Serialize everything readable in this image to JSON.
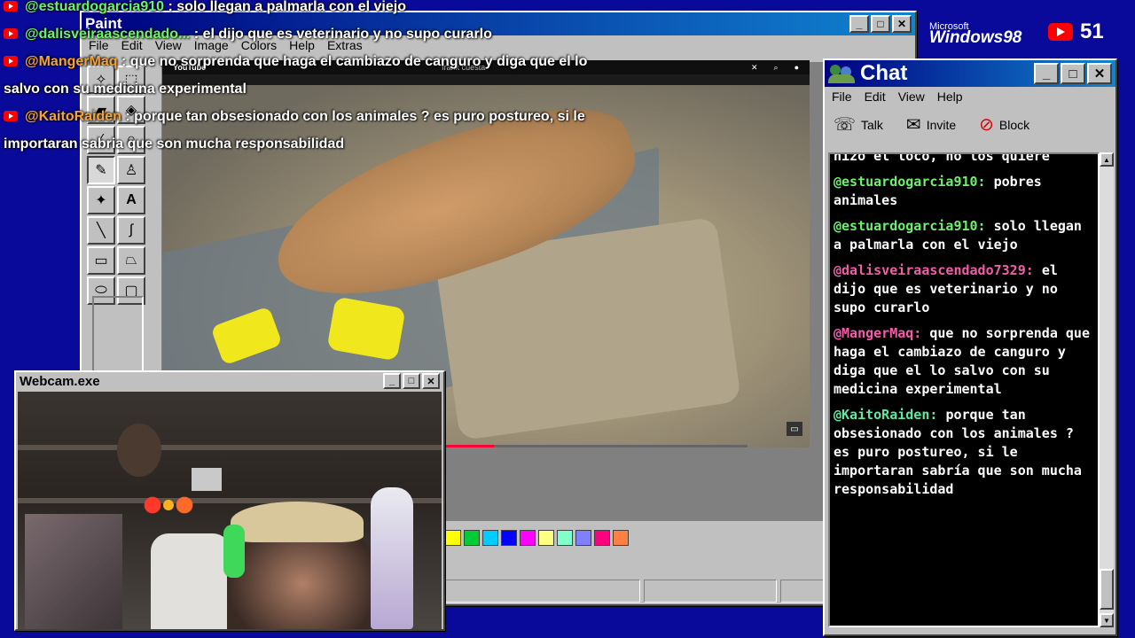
{
  "paint": {
    "title": "Paint",
    "menu": [
      "File",
      "Edit",
      "View",
      "Image",
      "Colors",
      "Help",
      "Extras"
    ]
  },
  "video": {
    "site": "YouTube",
    "query": "frank cuesta",
    "progress_fraction": 0.16
  },
  "palette": [
    "#ffff00",
    "#00cc33",
    "#00ccff",
    "#0000ff",
    "#ff00ff",
    "#ffff80",
    "#80ffcc",
    "#8080ff",
    "#ff0080",
    "#ff8040"
  ],
  "overlay": [
    {
      "user": "@estuardogarcia910",
      "sep": " : ",
      "text": "solo llegan a palmarla con el viejo",
      "color": "green"
    },
    {
      "user": "@dalisveiraascendado...",
      "sep": " : ",
      "text": "el dijo que es veterinario y no supo curarlo",
      "color": "green"
    },
    {
      "user": "@MangerMaq",
      "sep": " : ",
      "text": "que no sorprenda que haga el cambiazo de canguro y diga que el lo salvo con su medicina experimental",
      "color": "orange"
    },
    {
      "user": "@KaitoRaiden",
      "sep": " : ",
      "text": "porque tan obsesionado con los animales ? es puro postureo, si le importaran sabria que son mucha responsabilidad",
      "color": "orange"
    }
  ],
  "brand": {
    "microsoft": "Microsoft",
    "windows": "Windows98",
    "views": "51"
  },
  "chat": {
    "title": "Chat",
    "menu": [
      "File",
      "Edit",
      "View",
      "Help"
    ],
    "toolbar": {
      "talk": "Talk",
      "invite": "Invite",
      "block": "Block"
    },
    "partial_line": "hizo el loco, no los quiere",
    "messages": [
      {
        "user": "@estuardogarcia910:",
        "text": "pobres animales",
        "color": "green"
      },
      {
        "user": "@estuardogarcia910:",
        "text": "solo llegan a palmarla con el viejo",
        "color": "green"
      },
      {
        "user": "@dalisveiraascendado7329:",
        "text": "el dijo que es veterinario y no supo curarlo",
        "color": "pink"
      },
      {
        "user": "@MangerMaq:",
        "text": "que no sorprenda que haga el cambiazo de canguro y diga que el lo salvo con su medicina experimental",
        "color": "pink"
      },
      {
        "user": "@KaitoRaiden:",
        "text": "porque tan obsesionado con los animales ? es puro postureo, si le importaran sabría que son mucha responsabilidad",
        "color": "teal"
      }
    ]
  },
  "webcam": {
    "title": "Webcam.exe"
  },
  "window_buttons": {
    "minimize": "_",
    "maximize": "□",
    "close": "✕"
  }
}
